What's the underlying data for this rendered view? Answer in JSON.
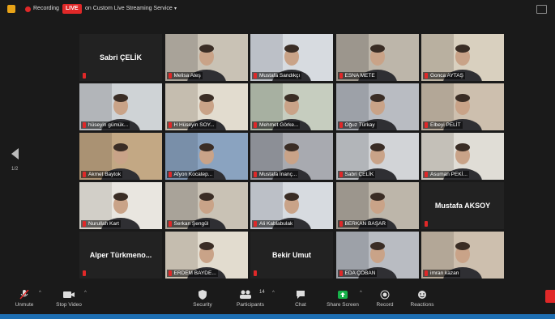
{
  "topbar": {
    "recording_label": "Recording",
    "live_badge": "LIVE",
    "live_service": "on Custom Live Streaming Service",
    "caret": "▾",
    "page_indicator": "1/2"
  },
  "colors": {
    "bg": "#1a1a1a",
    "tile": "#222222",
    "mute": "#e02828",
    "active_speaker": "#b7d03a",
    "share_green": "#17b24a"
  },
  "tiles": [
    {
      "label": "Sabri ÇELİK",
      "video": false
    },
    {
      "label": "Melisa Ateş",
      "video": true
    },
    {
      "label": "Mustafa Sandıkçı",
      "video": true
    },
    {
      "label": "ESNA METE",
      "video": true
    },
    {
      "label": "Gonca AYTAŞ",
      "video": true
    },
    {
      "label": "hüseyin gümük...",
      "video": true
    },
    {
      "label": "H Hüseyin SOY...",
      "video": true
    },
    {
      "label": "Mehmet Görke...",
      "video": true
    },
    {
      "label": "Oğuz Türkay",
      "video": true
    },
    {
      "label": "Elbeyi PELİT",
      "video": true,
      "active": true
    },
    {
      "label": "Akmet Baytok",
      "video": true
    },
    {
      "label": "Afyon Kocatep...",
      "video": true
    },
    {
      "label": "Mustafa İnanç...",
      "video": true
    },
    {
      "label": "Sabri ÇELİK",
      "video": true
    },
    {
      "label": "Asuman PEKİ...",
      "video": true
    },
    {
      "label": "Nurullah Kart",
      "video": true
    },
    {
      "label": "Serkan Şengül",
      "video": true
    },
    {
      "label": "Ali Kablabulak",
      "video": true
    },
    {
      "label": "BERKAN BAŞAR",
      "video": true
    },
    {
      "label": "",
      "center_name": "Mustafa AKSOY",
      "video": false
    },
    {
      "label": "",
      "center_name": "Alper Türkmeno...",
      "video": false
    },
    {
      "label": "ERDEM BAYDE...",
      "video": true
    },
    {
      "label": "",
      "center_name": "Bekir Umut",
      "video": false
    },
    {
      "label": "EDA ÇOBAN",
      "video": true
    },
    {
      "label": "imran kazan",
      "video": true
    }
  ],
  "toolbar": {
    "unmute": "Unmute",
    "stop_video": "Stop Video",
    "security": "Security",
    "participants": "Participants",
    "participants_count": "14",
    "chat": "Chat",
    "share_screen": "Share Screen",
    "record": "Record",
    "reactions": "Reactions"
  }
}
